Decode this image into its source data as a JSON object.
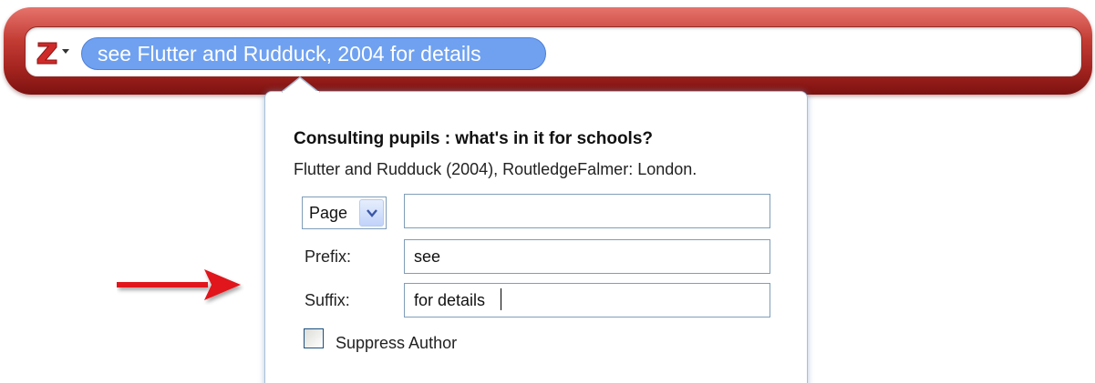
{
  "quick_format": {
    "citation_text": "see Flutter and Rudduck, 2004 for details",
    "logo_icon": "zotero-z-icon",
    "menu_icon": "dropdown-caret-icon"
  },
  "popup": {
    "title": "Consulting pupils : what's in it for schools?",
    "subtitle": "Flutter and Rudduck (2004), RoutledgeFalmer: London.",
    "locator": {
      "selected": "Page",
      "value": ""
    },
    "prefix": {
      "label": "Prefix:",
      "value": "see"
    },
    "suffix": {
      "label": "Suffix:",
      "value": "for details"
    },
    "suppress_author": {
      "label": "Suppress Author",
      "checked": false
    }
  },
  "annotation": {
    "arrow_icon": "red-arrow-icon"
  },
  "colors": {
    "bar_red": "#b3302b",
    "bubble_blue": "#6fa1f0",
    "arrow_red": "#e0161b"
  }
}
